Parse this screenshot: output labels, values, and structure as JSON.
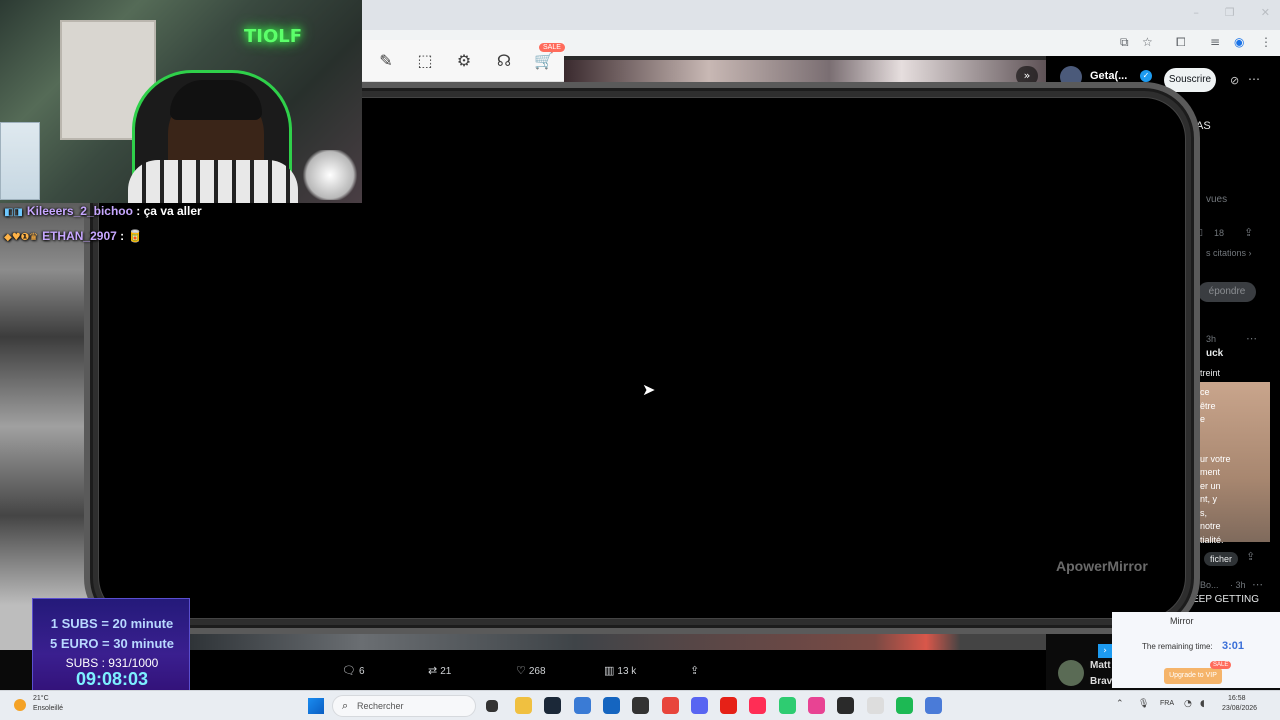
{
  "browser": {
    "window_controls": [
      "–",
      "❐",
      "✕"
    ],
    "toolbar_icons": [
      "cast-icon",
      "star-icon",
      "extensions-icon",
      "playlist-icon",
      "profile-icon",
      "menu-icon"
    ]
  },
  "apowermirror": {
    "sale_badge": "SALE",
    "watermark": "ApowerMirror",
    "tools": [
      "brush-icon",
      "select-area-icon",
      "settings-icon",
      "headset-icon",
      "cart-icon"
    ]
  },
  "stream": {
    "chat": [
      {
        "badges": "◧◨",
        "user": "Kileeers_2_bichoo",
        "message": " : ça va aller"
      },
      {
        "badges": "◆♥❶♛",
        "user": "ETHAN_2907",
        "message": " : 🥫"
      }
    ],
    "neon_sign": "TIOLF",
    "subathon": {
      "rule_1": "1 SUBS = 20 minute",
      "rule_2": "5 EURO = 30 minute",
      "subs_count": "SUBS : 931/1000",
      "timer": "09:08:03"
    }
  },
  "twitter": {
    "profile_name": "Geta(...",
    "subscribe_label": "Souscrire",
    "fragments": {
      "as": "AS",
      "views": "vues",
      "count_18": "18",
      "quotes": "s citations ›",
      "reply": "épondre",
      "time_3h": "3h",
      "uck": "uck",
      "treint": "treint",
      "text_lines": [
        "ce",
        "être",
        "e",
        "",
        "",
        "ur votre",
        "ment",
        "er un",
        "nt, y",
        "s,",
        "notre",
        "tialité."
      ],
      "afficher": "ficher",
      "bo": "Bo...",
      "time_3h_b": "· 3h",
      "keep": "EEP GETTING"
    },
    "actions": {
      "replies": "6",
      "retweets": "21",
      "likes": "268",
      "views": "13 k"
    },
    "player": {
      "name": "Matt",
      "sub": "Brave"
    }
  },
  "vip_popup": {
    "title": "Mirror",
    "remaining_label": "The remaining time:",
    "remaining_time": "3:01",
    "upgrade_label": "Upgrade to VIP",
    "sale": "SALE"
  },
  "taskbar": {
    "weather_temp": "21°C",
    "weather_desc": "Ensoleillé",
    "search_placeholder": "Rechercher",
    "language": "FRA",
    "time": "16:58",
    "date": "23/08/2026",
    "apps": [
      {
        "name": "file-explorer-icon",
        "color": "#f0c040"
      },
      {
        "name": "steam-icon",
        "color": "#1b2838"
      },
      {
        "name": "store-icon",
        "color": "#3a7bd5"
      },
      {
        "name": "outlook-icon",
        "color": "#1565c0"
      },
      {
        "name": "obs-icon",
        "color": "#333333"
      },
      {
        "name": "chrome-icon",
        "color": "#e8453c"
      },
      {
        "name": "discord-icon",
        "color": "#5865f2"
      },
      {
        "name": "youtube-icon",
        "color": "#e62117"
      },
      {
        "name": "tiktok-icon",
        "color": "#ff2d55"
      },
      {
        "name": "app-green-icon",
        "color": "#2ecc71"
      },
      {
        "name": "app-pink-icon",
        "color": "#e84393"
      },
      {
        "name": "epic-icon",
        "color": "#2a2a2a"
      },
      {
        "name": "file-icon",
        "color": "#dddddd"
      },
      {
        "name": "spotify-icon",
        "color": "#1db954"
      },
      {
        "name": "apowermirror-icon",
        "color": "#4a7bd8"
      }
    ]
  }
}
